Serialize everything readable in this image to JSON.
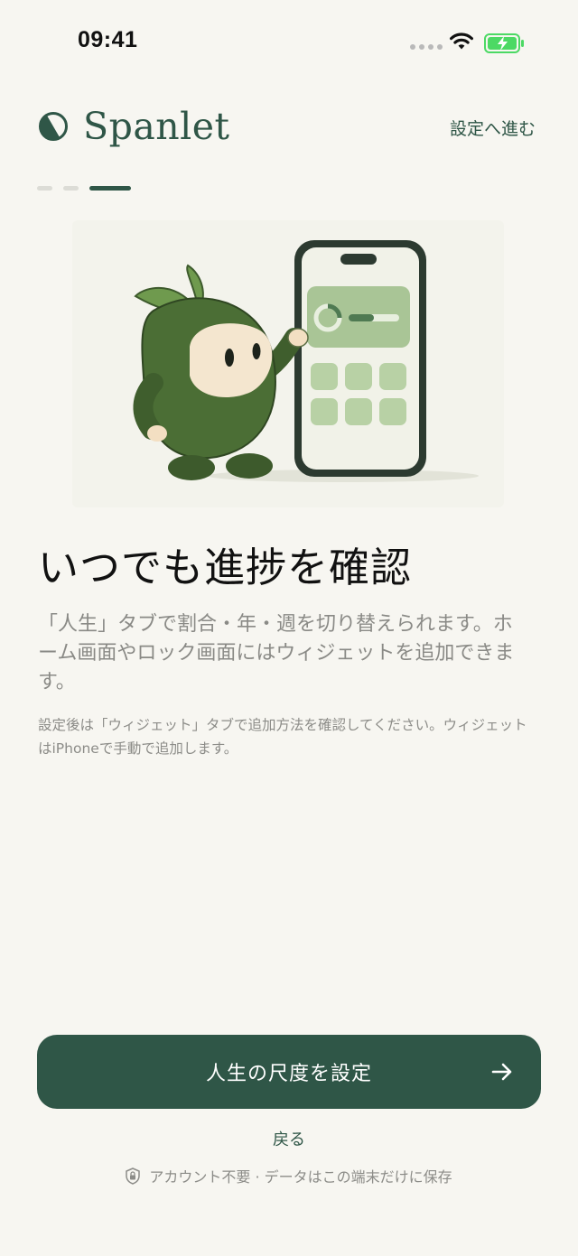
{
  "status_bar": {
    "time": "09:41",
    "icons": [
      "signal-icon",
      "wifi-icon",
      "battery-charging-icon"
    ],
    "battery_color": "#4cd964"
  },
  "header": {
    "brand": "Spanlet",
    "logo_icon": "half-circle-logo-icon",
    "skip_label": "設定へ進む"
  },
  "progress": {
    "total": 3,
    "current": 3
  },
  "illustration": {
    "icon": "mascot-pointing-at-phone-widget-illustration"
  },
  "content": {
    "title": "いつでも進捗を確認",
    "body": "「人生」タブで割合・年・週を切り替えられます。ホーム画面やロック画面にはウィジェットを追加できます。",
    "note": "設定後は「ウィジェット」タブで追加方法を確認してください。ウィジェットはiPhoneで手動で追加します。"
  },
  "actions": {
    "primary_label": "人生の尺度を設定",
    "primary_icon": "arrow-right-icon",
    "back_label": "戻る"
  },
  "footer": {
    "icon": "lock-shield-icon",
    "text": "アカウント不要 · データはこの端末だけに保存"
  },
  "colors": {
    "background": "#f7f6f1",
    "accent": "#2f5647",
    "muted_text": "#8a8a86"
  }
}
